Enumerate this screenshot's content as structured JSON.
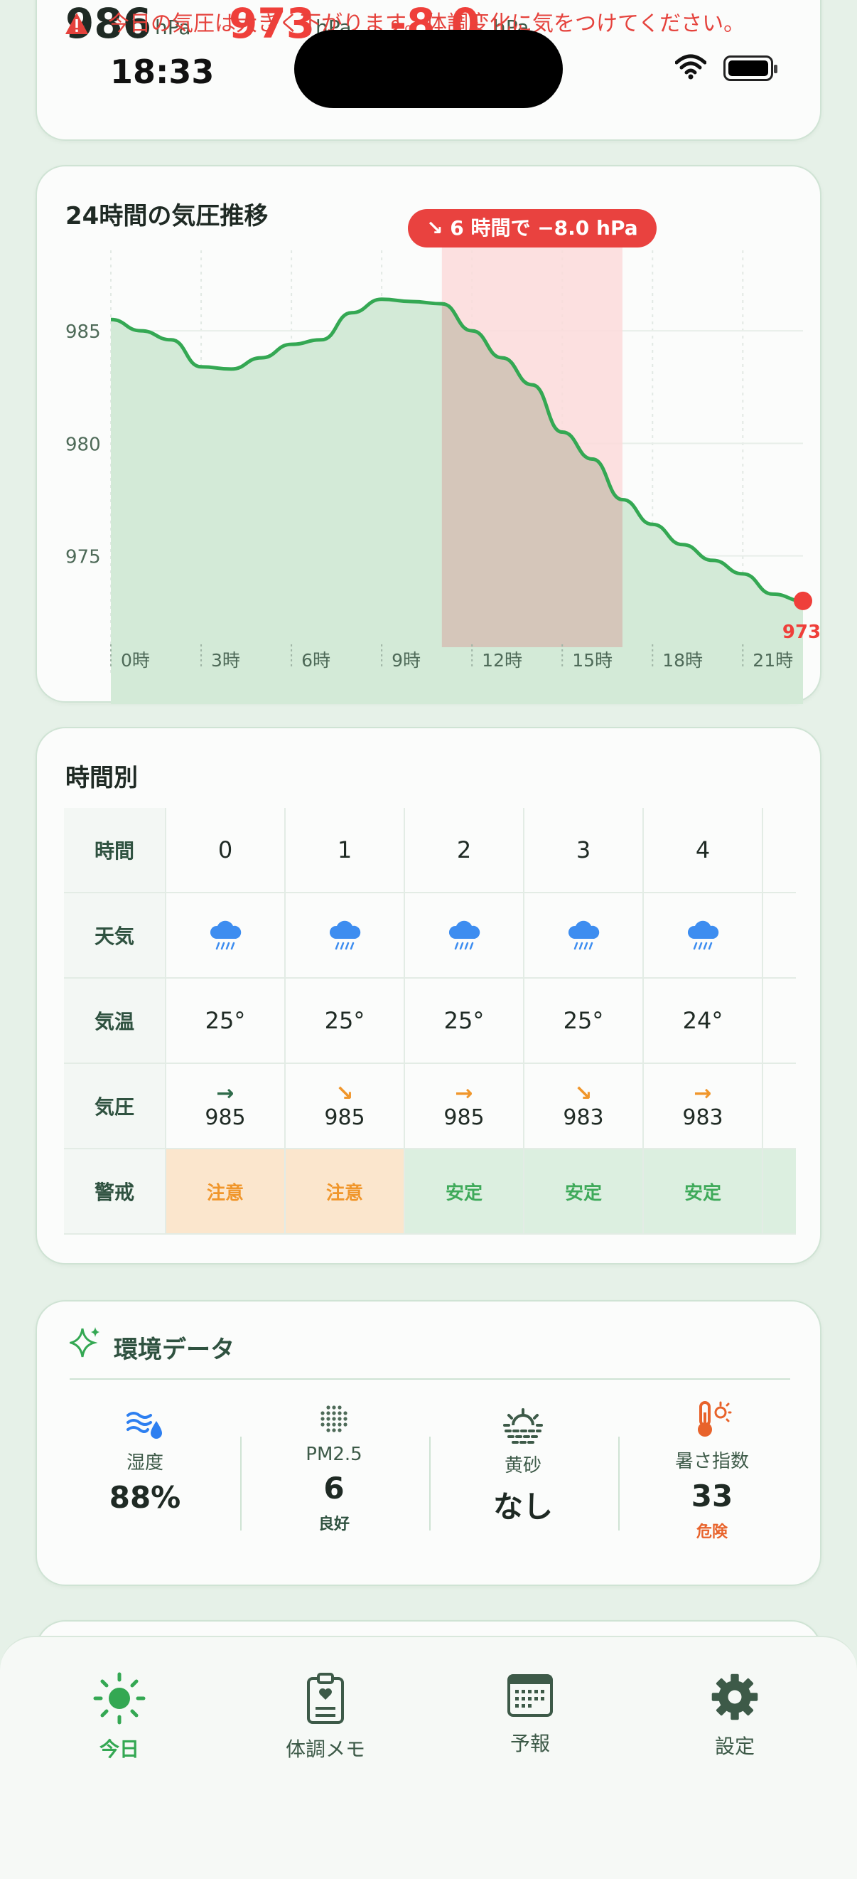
{
  "status_bar": {
    "time": "18:33"
  },
  "summary": {
    "values": [
      {
        "value": "986",
        "unit": "hPa",
        "color": "#1f2a24"
      },
      {
        "value": "973",
        "unit": "hPa",
        "color": "#ef3f3a"
      },
      {
        "value": "-8.0",
        "unit": "hPa",
        "color": "#ef3f3a"
      }
    ],
    "warning_text": "今日の気圧は大きく下がります。体調変化に気をつけてください。"
  },
  "pressure_chart": {
    "title": "24時間の気圧推移",
    "drop_badge": "6 時間で −8.0 hPa",
    "current_label": "973"
  },
  "chart_data": {
    "type": "area",
    "x": [
      0,
      1,
      2,
      3,
      4,
      5,
      6,
      7,
      8,
      9,
      10,
      11,
      12,
      13,
      14,
      15,
      16,
      17,
      18,
      19,
      20,
      21,
      22,
      23
    ],
    "values": [
      985.5,
      985.0,
      984.6,
      983.4,
      983.3,
      983.8,
      984.4,
      984.6,
      985.8,
      986.4,
      986.3,
      986.2,
      985.0,
      983.8,
      982.6,
      980.5,
      979.3,
      977.5,
      976.4,
      975.5,
      974.8,
      974.2,
      973.3,
      973.0
    ],
    "x_tick_labels": [
      "0時",
      "3時",
      "6時",
      "9時",
      "12時",
      "15時",
      "18時",
      "21時"
    ],
    "x_tick_positions": [
      0,
      3,
      6,
      9,
      12,
      15,
      18,
      21
    ],
    "y_ticks": [
      975,
      980,
      985
    ],
    "ylim": [
      970.5,
      987.5
    ],
    "highlight_range": [
      11,
      17
    ],
    "line_color": "#34a853",
    "fill_color": "#d3ead7",
    "highlight_color": "#fbdadb"
  },
  "hourly": {
    "title": "時間別",
    "row_labels": [
      "時間",
      "天気",
      "気温",
      "気圧",
      "警戒"
    ],
    "hours": [
      {
        "hour": "0",
        "weather": "rain",
        "temp": "25°",
        "trend": "→",
        "trend_color": "#2f6b4a",
        "pressure": "985",
        "alert": "注意",
        "alert_type": "caution"
      },
      {
        "hour": "1",
        "weather": "rain",
        "temp": "25°",
        "trend": "↘",
        "trend_color": "#f0962b",
        "pressure": "985",
        "alert": "注意",
        "alert_type": "caution"
      },
      {
        "hour": "2",
        "weather": "rain",
        "temp": "25°",
        "trend": "→",
        "trend_color": "#f0962b",
        "pressure": "985",
        "alert": "安定",
        "alert_type": "stable"
      },
      {
        "hour": "3",
        "weather": "rain",
        "temp": "25°",
        "trend": "↘",
        "trend_color": "#f0962b",
        "pressure": "983",
        "alert": "安定",
        "alert_type": "stable"
      },
      {
        "hour": "4",
        "weather": "rain",
        "temp": "24°",
        "trend": "→",
        "trend_color": "#f0962b",
        "pressure": "983",
        "alert": "安定",
        "alert_type": "stable"
      }
    ]
  },
  "environment": {
    "title": "環境データ",
    "items": [
      {
        "icon": "humidity-icon",
        "label": "湿度",
        "value": "88%",
        "note": "",
        "note_color": ""
      },
      {
        "icon": "pm25-icon",
        "label": "PM2.5",
        "value": "6",
        "note": "良好",
        "note_color": "#2f5240"
      },
      {
        "icon": "yellow-sand-icon",
        "label": "黄砂",
        "value": "なし",
        "note": "",
        "note_color": ""
      },
      {
        "icon": "heat-index-icon",
        "label": "暑さ指数",
        "value": "33",
        "note": "危険",
        "note_color": "#e8632b"
      }
    ]
  },
  "nav": {
    "items": [
      {
        "label": "今日",
        "icon": "sun-icon",
        "active": true
      },
      {
        "label": "体調メモ",
        "icon": "clipboard-heart-icon",
        "active": false
      },
      {
        "label": "予報",
        "icon": "calendar-icon",
        "active": false
      },
      {
        "label": "設定",
        "icon": "gear-icon",
        "active": false
      }
    ],
    "active_color": "#34a853",
    "inactive_color": "#3d5a48"
  }
}
